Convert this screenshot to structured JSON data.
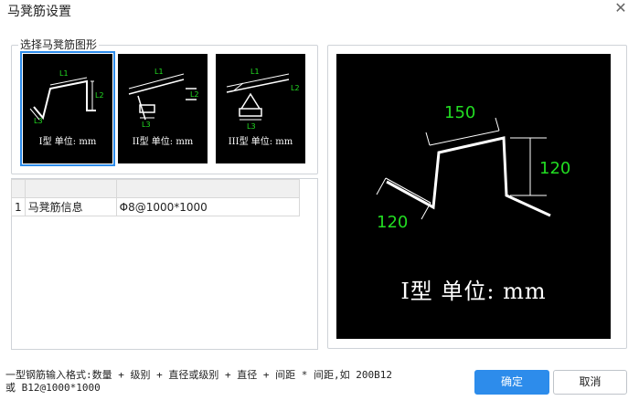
{
  "dialog": {
    "title": "马凳筋设置",
    "close_glyph": "✕"
  },
  "shapes_group": {
    "label": "选择马凳筋图形",
    "options": [
      {
        "caption": "I型 单位: mm",
        "dims": [
          "L1",
          "L2",
          "L3"
        ],
        "selected": true
      },
      {
        "caption": "II型 单位: mm",
        "dims": [
          "L1",
          "L2",
          "L3"
        ],
        "selected": false
      },
      {
        "caption": "III型 单位: mm",
        "dims": [
          "L1",
          "L2",
          "L3"
        ],
        "selected": false
      }
    ]
  },
  "info_table": {
    "header": [
      "",
      "",
      ""
    ],
    "rows": [
      {
        "index": "1",
        "name": "马凳筋信息",
        "value": "Φ8@1000*1000"
      }
    ]
  },
  "preview": {
    "dim_top": "150",
    "dim_right": "120",
    "dim_left": "120",
    "caption": "I型 单位: mm"
  },
  "hint": {
    "line1": "一型钢筋输入格式:数量 + 级别 + 直径或级别 + 直径 + 间距 * 间距,如 200B12",
    "line2": "或 B12@1000*1000"
  },
  "buttons": {
    "ok": "确定",
    "cancel": "取消"
  },
  "colors": {
    "accent": "#2d8ceb",
    "dimension_green": "#22dd22"
  }
}
